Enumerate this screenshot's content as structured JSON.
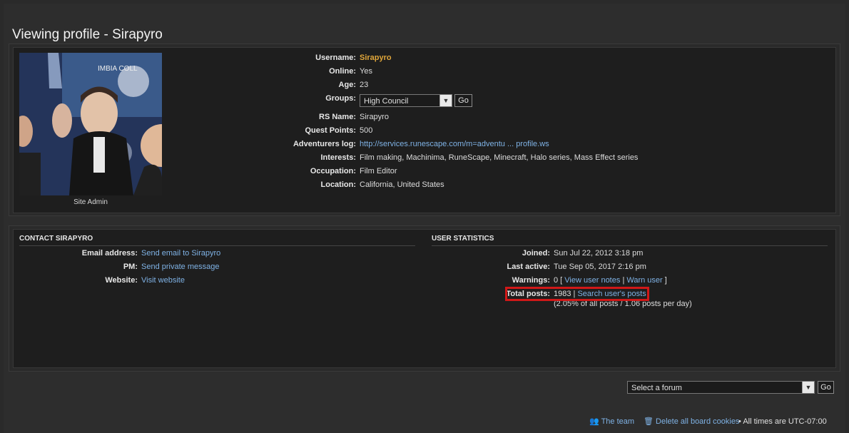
{
  "page_title": "Viewing profile - Sirapyro",
  "avatar_caption": "Site Admin",
  "profile": {
    "username_label": "Username:",
    "username": "Sirapyro",
    "online_label": "Online:",
    "online": "Yes",
    "age_label": "Age:",
    "age": "23",
    "groups_label": "Groups:",
    "groups_selected": "High Council",
    "groups_go": "Go",
    "rsname_label": "RS Name:",
    "rsname": "Sirapyro",
    "quest_label": "Quest Points:",
    "quest": "500",
    "advlog_label": "Adventurers log:",
    "advlog": "http://services.runescape.com/m=adventu ... profile.ws",
    "interests_label": "Interests:",
    "interests": "Film making, Machinima, RuneScape, Minecraft, Halo series, Mass Effect series",
    "occupation_label": "Occupation:",
    "occupation": "Film Editor",
    "location_label": "Location:",
    "location": "California, United States"
  },
  "contact": {
    "heading": "CONTACT SIRAPYRO",
    "email_label": "Email address:",
    "email": "Send email to Sirapyro",
    "pm_label": "PM:",
    "pm": "Send private message",
    "website_label": "Website:",
    "website": "Visit website"
  },
  "stats": {
    "heading": "USER STATISTICS",
    "joined_label": "Joined:",
    "joined": "Sun Jul 22, 2012 3:18 pm",
    "active_label": "Last active:",
    "active": "Tue Sep 05, 2017 2:16 pm",
    "warnings_label": "Warnings:",
    "warnings_count": "0 [",
    "view_notes": "View user notes",
    "sep": "|",
    "warn_user": "Warn user",
    "close_bracket": "]",
    "posts_label": "Total posts:",
    "posts_count": "1983 |",
    "search_posts": "Search user's posts",
    "posts_detail": "(2.05% of all posts / 1.06 posts per day)"
  },
  "jump": {
    "select_placeholder": "Select a forum",
    "go": "Go"
  },
  "footer": {
    "team": "The team",
    "delete_cookies": "Delete all board cookies",
    "timezone": "All times are UTC-07:00"
  }
}
